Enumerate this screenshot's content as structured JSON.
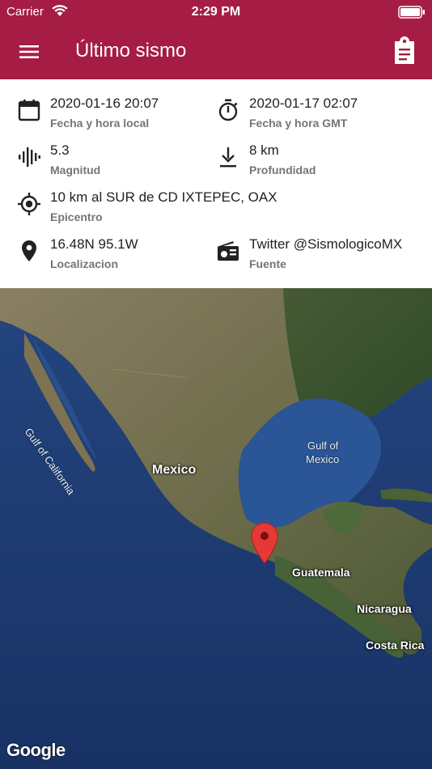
{
  "status_bar": {
    "carrier": "Carrier",
    "time": "2:29 PM"
  },
  "toolbar": {
    "title": "Último sismo",
    "menu_icon": "hamburger-menu-icon",
    "action_icon": "clipboard-icon"
  },
  "details": {
    "local_time": {
      "value": "2020-01-16 20:07",
      "label": "Fecha y hora local",
      "icon": "calendar-icon"
    },
    "gmt_time": {
      "value": "2020-01-17 02:07",
      "label": "Fecha y hora GMT",
      "icon": "timer-icon"
    },
    "magnitude": {
      "value": "5.3",
      "label": "Magnitud",
      "icon": "waveform-icon"
    },
    "depth": {
      "value": "8 km",
      "label": "Profundidad",
      "icon": "depth-arrow-icon"
    },
    "epicenter": {
      "value": "10 km al SUR de CD IXTEPEC, OAX",
      "label": "Epicentro",
      "icon": "crosshair-icon"
    },
    "location": {
      "value": "16.48N 95.1W",
      "label": "Localizacion",
      "icon": "location-pin-icon"
    },
    "source": {
      "value": "Twitter @SismologicoMX",
      "label": "Fuente",
      "icon": "radio-icon"
    }
  },
  "map": {
    "labels": {
      "gulf_california": "Gulf of California",
      "mexico": "Mexico",
      "gulf_mexico_1": "Gulf of",
      "gulf_mexico_2": "Mexico",
      "guatemala": "Guatemala",
      "nicaragua": "Nicaragua",
      "costa_rica": "Costa Rica"
    },
    "attribution": "Google",
    "marker_icon": "map-marker-icon"
  },
  "colors": {
    "header": "#a51d44",
    "marker": "#e53935"
  }
}
